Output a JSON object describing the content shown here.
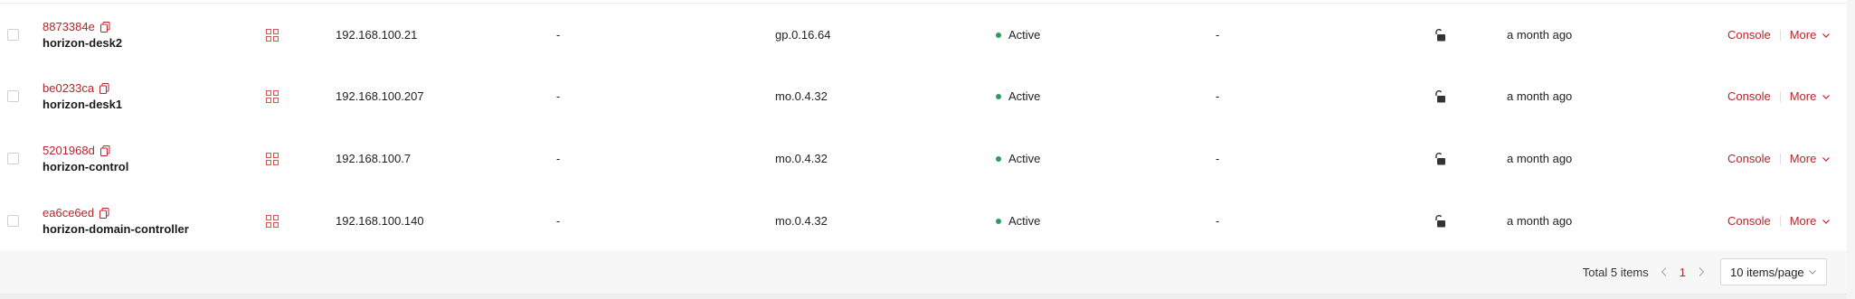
{
  "rows": [
    {
      "id": "8873384e",
      "name": "horizon-desk2",
      "ip": "192.168.100.21",
      "floating_ip": "-",
      "flavor": "gp.0.16.64",
      "status": "Active",
      "task": "-",
      "created": "a month ago"
    },
    {
      "id": "be0233ca",
      "name": "horizon-desk1",
      "ip": "192.168.100.207",
      "floating_ip": "-",
      "flavor": "mo.0.4.32",
      "status": "Active",
      "task": "-",
      "created": "a month ago"
    },
    {
      "id": "5201968d",
      "name": "horizon-control",
      "ip": "192.168.100.7",
      "floating_ip": "-",
      "flavor": "mo.0.4.32",
      "status": "Active",
      "task": "-",
      "created": "a month ago"
    },
    {
      "id": "ea6ce6ed",
      "name": "horizon-domain-controller",
      "ip": "192.168.100.140",
      "floating_ip": "-",
      "flavor": "mo.0.4.32",
      "status": "Active",
      "task": "-",
      "created": "a month ago"
    }
  ],
  "actions": {
    "console_label": "Console",
    "more_label": "More"
  },
  "pagination": {
    "total_label": "Total 5 items",
    "current_page": "1",
    "page_size_label": "10 items/page"
  },
  "icons": {
    "copy": "copy-icon",
    "type": "instance-type-icon",
    "lock": "unlock-icon",
    "status_dot": "status-dot",
    "chevron": "chevron-down-icon"
  },
  "colors": {
    "accent": "#b5252b",
    "status_active": "#2a9d5c",
    "footer_bg": "#f7f7f7"
  }
}
